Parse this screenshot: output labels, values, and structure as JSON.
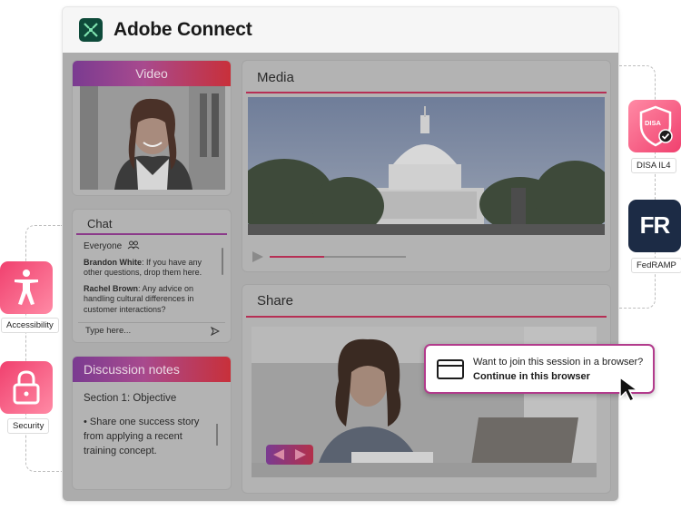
{
  "app": {
    "title": "Adobe Connect"
  },
  "video": {
    "title": "Video"
  },
  "chat": {
    "title": "Chat",
    "audience": "Everyone",
    "messages": [
      {
        "author": "Brandon White",
        "text": "If you have any other questions, drop them here."
      },
      {
        "author": "Rachel Brown",
        "text": "Any advice on handling cultural differences in customer interactions?"
      }
    ],
    "input_placeholder": "Type here..."
  },
  "notes": {
    "title": "Discussion notes",
    "section": "Section 1: Objective",
    "bullet": "• Share one success story from applying a recent training concept."
  },
  "media": {
    "title": "Media",
    "progress": 0.4
  },
  "share": {
    "title": "Share"
  },
  "popup": {
    "question": "Want to join this session in a browser?",
    "link": "Continue in this browser"
  },
  "badges": {
    "accessibility": "Accessibility",
    "security": "Security",
    "disa": "DISA IL4",
    "disa_shield_text": "DISA",
    "fedramp": "FedRAMP",
    "fedramp_mark": "FR"
  },
  "colors": {
    "accent_purple": "#7a3b91",
    "accent_red": "#c8303a",
    "pink_badge": "#f0406e",
    "fedramp_navy": "#1c2b45"
  }
}
